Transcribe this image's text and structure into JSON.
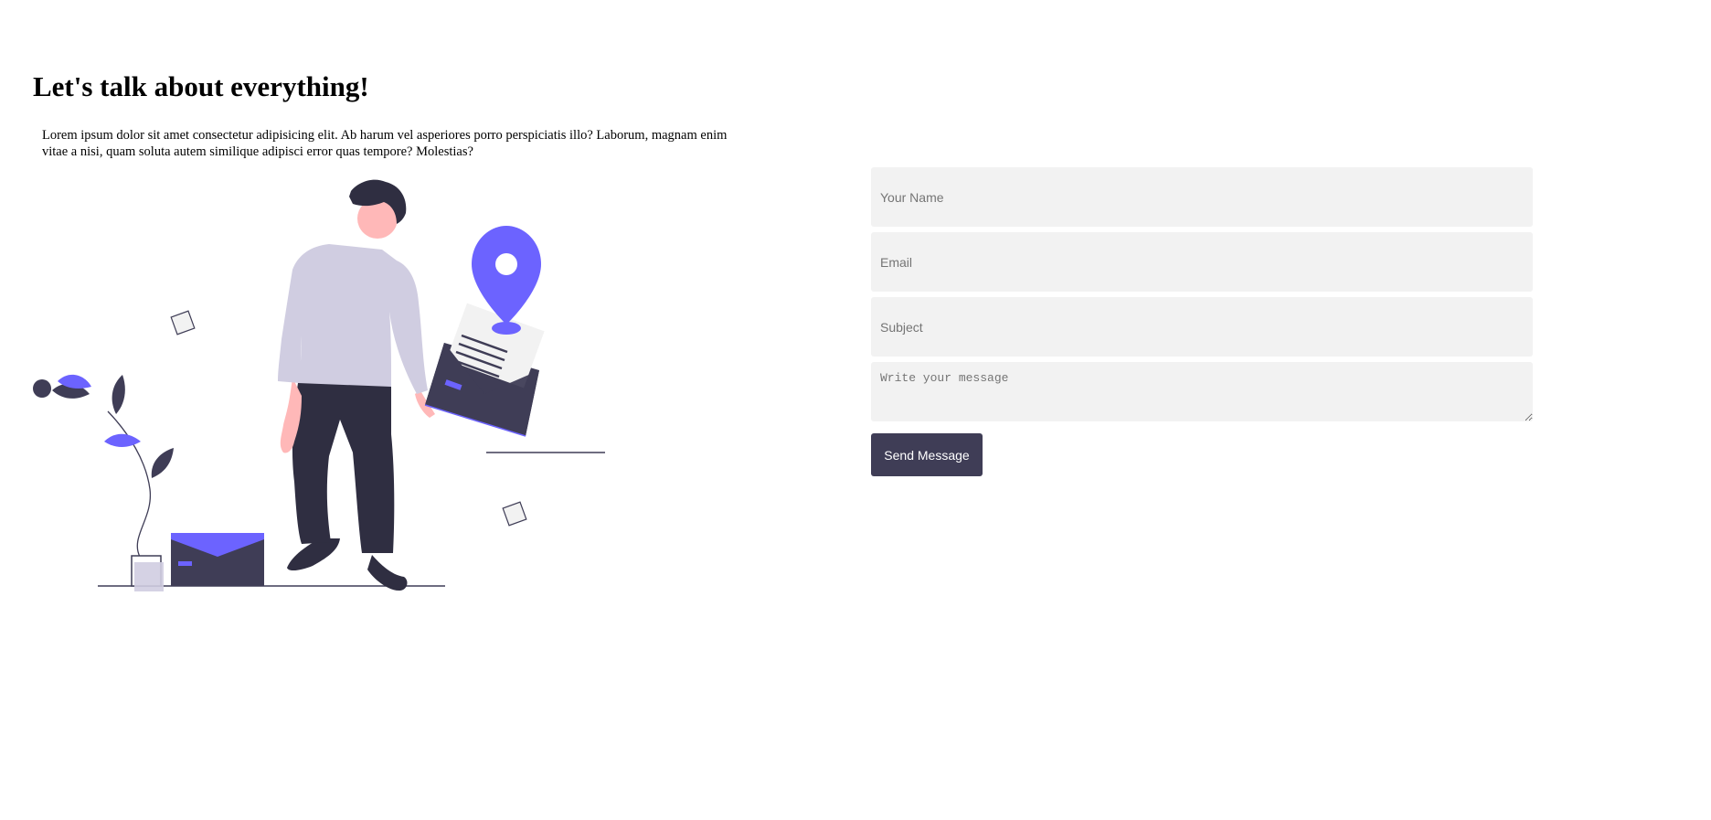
{
  "header": {
    "title": "Let's talk about everything!",
    "intro": "Lorem ipsum dolor sit amet consectetur adipisicing elit. Ab harum vel asperiores porro perspiciatis illo? Laborum, magnam enim vitae a nisi, quam soluta autem similique adipisci error quas tempore? Molestias?"
  },
  "illustration": {
    "icon": "contact-illustration",
    "colors": {
      "dark": "#3f3d56",
      "pants": "#2f2e41",
      "sweater": "#d0cde1",
      "skin": "#ffb8b8",
      "accent": "#6c63ff",
      "paper": "#f2f2f2"
    }
  },
  "form": {
    "name_placeholder": "Your Name",
    "email_placeholder": "Email",
    "subject_placeholder": "Subject",
    "message_placeholder": "Write your message",
    "submit_label": "Send Message",
    "field_background": "#f2f2f2",
    "button_color": "#3f3d56"
  }
}
